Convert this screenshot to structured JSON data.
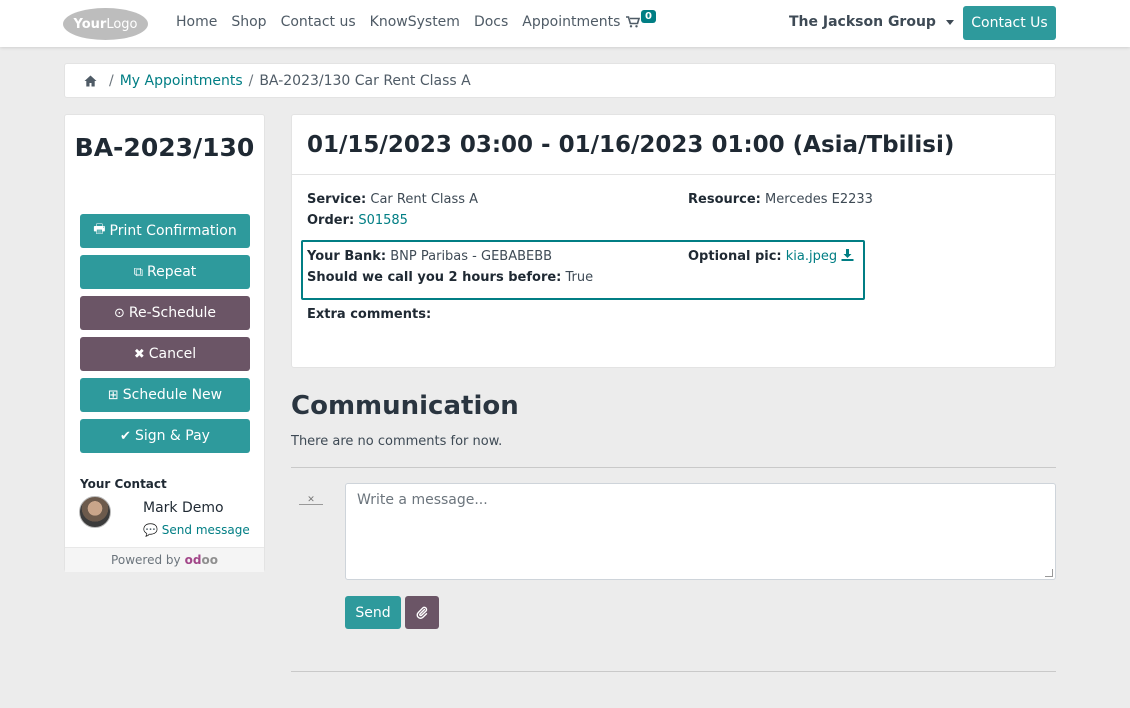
{
  "header": {
    "logo_part1": "Your",
    "logo_part2": "Logo",
    "nav": [
      "Home",
      "Shop",
      "Contact us",
      "KnowSystem",
      "Docs",
      "Appointments"
    ],
    "cart_count": "0",
    "company": "The Jackson Group",
    "contact_button": "Contact Us"
  },
  "breadcrumb": {
    "link": "My Appointments",
    "sep1": "/",
    "sep2": "/",
    "current": "BA-2023/130 Car Rent Class A"
  },
  "sidebar": {
    "title": "BA-2023/130",
    "buttons": [
      {
        "label": "Print Confirmation",
        "icon": "🖶"
      },
      {
        "label": "Repeat",
        "icon": "⧉"
      },
      {
        "label": "Re-Schedule",
        "icon": "⊙"
      },
      {
        "label": "Cancel",
        "icon": "✖"
      },
      {
        "label": "Schedule New",
        "icon": "⊞"
      },
      {
        "label": "Sign & Pay",
        "icon": "✔"
      }
    ],
    "your_contact": "Your Contact",
    "contact_name": "Mark Demo",
    "send_message": "Send message",
    "powered_by": "Powered by",
    "odoo_a": "od",
    "odoo_b": "oo"
  },
  "appointment": {
    "datetime": "01/15/2023 03:00 - 01/16/2023 01:00 (Asia/Tbilisi)",
    "service_label": "Service:",
    "service_value": "Car Rent Class A",
    "resource_label": "Resource:",
    "resource_value": "Mercedes E2233",
    "order_label": "Order:",
    "order_value": "S01585",
    "bank_label": "Your Bank:",
    "bank_value": "BNP Paribas - GEBABEBB",
    "optional_pic_label": "Optional pic:",
    "optional_pic_value": "kia.jpeg",
    "call_label": "Should we call you 2 hours before:",
    "call_value": "True",
    "extra_comments_label": "Extra comments:"
  },
  "communication": {
    "title": "Communication",
    "empty": "There are no comments for now.",
    "placeholder": "Write a message...",
    "send_button": "Send"
  },
  "colors": {
    "accent": "#2e9a9c",
    "secondary": "#6b5566",
    "link": "#017e84"
  }
}
